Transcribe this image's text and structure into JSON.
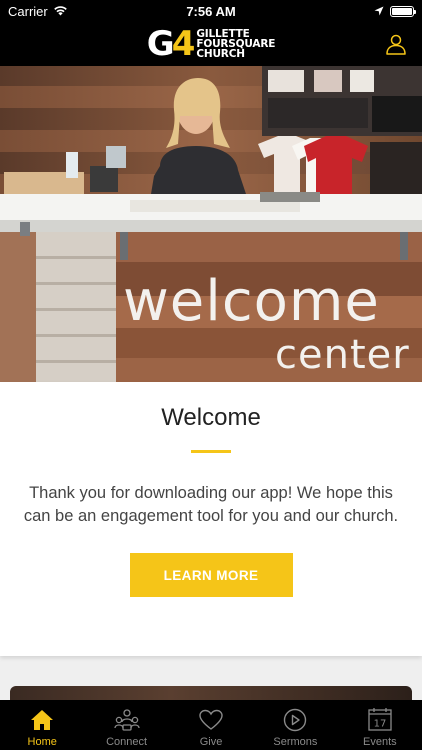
{
  "status_bar": {
    "carrier": "Carrier",
    "time": "7:56 AM",
    "battery_level": 1.0
  },
  "header": {
    "logo_mark_g": "G",
    "logo_mark_four": "4",
    "logo_line1": "GILLETTE",
    "logo_line2": "FOURSQUARE",
    "logo_line3": "CHURCH"
  },
  "hero": {
    "sign_line1": "welcome",
    "sign_line2": "center"
  },
  "card": {
    "title": "Welcome",
    "body": "Thank you for downloading our app! We hope this can be an engagement tool for you and our church.",
    "button_label": "LEARN MORE"
  },
  "tabs": [
    {
      "label": "Home",
      "icon": "home-icon",
      "active": true
    },
    {
      "label": "Connect",
      "icon": "connect-icon",
      "active": false
    },
    {
      "label": "Give",
      "icon": "heart-icon",
      "active": false
    },
    {
      "label": "Sermons",
      "icon": "play-icon",
      "active": false
    },
    {
      "label": "Events",
      "icon": "calendar-icon",
      "active": false
    }
  ],
  "calendar_day": "17",
  "colors": {
    "accent": "#f5c518",
    "bar_background": "#000000",
    "inactive_tab": "#8a8a8a"
  }
}
